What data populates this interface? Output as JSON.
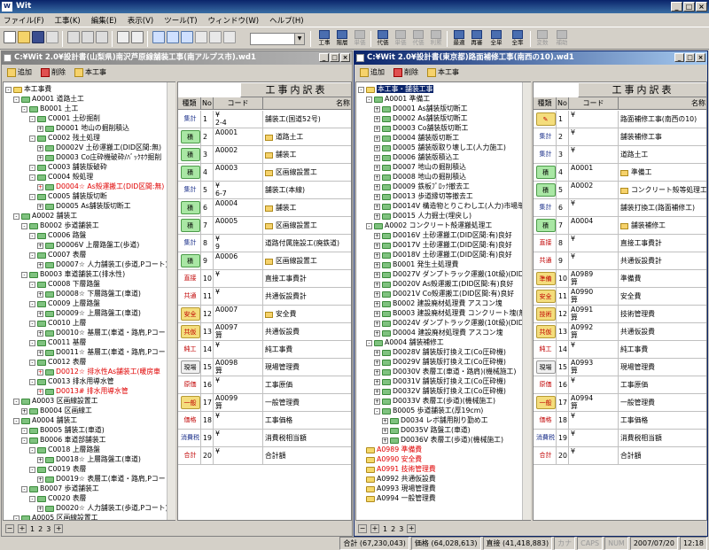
{
  "app": {
    "title": "Wit",
    "icon_label": "W"
  },
  "window_buttons": [
    "_",
    "□",
    "×"
  ],
  "menu": [
    "ファイル(F)",
    "工事(K)",
    "編集(E)",
    "表示(V)",
    "ツール(T)",
    "ウィンドウ(W)",
    "ヘルプ(H)"
  ],
  "toolbar": {
    "right_buttons": [
      {
        "label": "工事",
        "disabled": false
      },
      {
        "label": "階層",
        "disabled": false
      },
      {
        "label": "単価",
        "disabled": true
      },
      {
        "label": "代価",
        "disabled": false
      },
      {
        "label": "単価",
        "disabled": true
      },
      {
        "label": "代価",
        "disabled": true
      },
      {
        "label": "利累",
        "disabled": true
      },
      {
        "label": "最適",
        "disabled": false
      },
      {
        "label": "再審",
        "disabled": false
      },
      {
        "label": "全単",
        "disabled": false
      },
      {
        "label": "全率",
        "disabled": false
      },
      {
        "label": "変数",
        "disabled": true
      },
      {
        "label": "補助",
        "disabled": true
      }
    ]
  },
  "left_window": {
    "title": "C:¥Wit 2.0¥設計書(山梨県)南沢芦原線舗装工事(南アルプス市).wd1",
    "toolbar": {
      "add": "追加",
      "delete": "削除",
      "main": "本工事"
    },
    "grid_title": "工事内訳表",
    "columns": {
      "kind": "種類",
      "no": "No",
      "code": "コード",
      "name": "名称"
    },
    "tree": [
      {
        "level": 0,
        "text": "本工事費",
        "folder": "y",
        "pm": "-"
      },
      {
        "level": 1,
        "text": "A0001 道路土工",
        "pm": "-"
      },
      {
        "level": 2,
        "text": "B0001 土工",
        "pm": "-"
      },
      {
        "level": 3,
        "text": "C0001 土砂掘削",
        "pm": "-"
      },
      {
        "level": 4,
        "text": "D0001 地山の掘削積込",
        "pm": "+"
      },
      {
        "level": 3,
        "text": "C0002 残土処理",
        "pm": "-"
      },
      {
        "level": 4,
        "text": "D0002V 土砂運搬工(DID区間:無)",
        "pm": "+"
      },
      {
        "level": 4,
        "text": "D0003 Co庄砕機破砕/ﾊﾞｯｸﾎｳ掘削",
        "pm": "+"
      },
      {
        "level": 3,
        "text": "C0003 舗装版破砕",
        "pm": "-"
      },
      {
        "level": 3,
        "text": "C0004 殻処理",
        "pm": "-"
      },
      {
        "level": 4,
        "text": "D0004☆ As殻運搬工(DID区間:無)",
        "pm": "+",
        "red": true
      },
      {
        "level": 3,
        "text": "C0005 舗装版切断",
        "pm": "-"
      },
      {
        "level": 4,
        "text": "D0005 As舗装版切断工",
        "pm": "+"
      },
      {
        "level": 1,
        "text": "A0002 舗装工",
        "pm": "-"
      },
      {
        "level": 2,
        "text": "B0002 歩道舗装工",
        "pm": "-"
      },
      {
        "level": 3,
        "text": "C0006 路盤",
        "pm": "-"
      },
      {
        "level": 4,
        "text": "D0006V 上層路盤工(歩道)",
        "pm": "+"
      },
      {
        "level": 3,
        "text": "C0007 表層",
        "pm": "-"
      },
      {
        "level": 4,
        "text": "D0007☆ 人力舗装工(歩道,Pコート)",
        "pm": "+"
      },
      {
        "level": 2,
        "text": "B0003 車道舗装工(排水性)",
        "pm": "-"
      },
      {
        "level": 3,
        "text": "C0008 下層路盤",
        "pm": "-"
      },
      {
        "level": 4,
        "text": "D0008☆ 下層路盤工(車道)",
        "pm": "+"
      },
      {
        "level": 3,
        "text": "C0009 上層路盤",
        "pm": "-"
      },
      {
        "level": 4,
        "text": "D0009☆ 上層路盤工(車道)",
        "pm": "+"
      },
      {
        "level": 3,
        "text": "C0010 上層",
        "pm": "-"
      },
      {
        "level": 4,
        "text": "D0010☆ 基層工(車道・路肩,Pコート)",
        "pm": "+"
      },
      {
        "level": 3,
        "text": "C0011 基層",
        "pm": "-"
      },
      {
        "level": 4,
        "text": "D0011☆ 基層工(車道・路肩,Pコート)",
        "pm": "+"
      },
      {
        "level": 3,
        "text": "C0012 表層",
        "pm": "-"
      },
      {
        "level": 4,
        "text": "D0012☆ 排水性As舗装工(暖房車",
        "pm": "+",
        "red": true
      },
      {
        "level": 3,
        "text": "C0013 排水用導水管",
        "pm": "-"
      },
      {
        "level": 4,
        "text": "D0013# 排水用導水管",
        "pm": "+",
        "red": true
      },
      {
        "level": 1,
        "text": "A0003 区画線設置工",
        "pm": "-"
      },
      {
        "level": 2,
        "text": "B0004 区画線工",
        "pm": "+"
      },
      {
        "level": 1,
        "text": "A0004 舗装工",
        "pm": "-"
      },
      {
        "level": 2,
        "text": "B0005 舗装工(車道)",
        "pm": "-"
      },
      {
        "level": 2,
        "text": "B0006 車道部舗装工",
        "pm": "-"
      },
      {
        "level": 3,
        "text": "C0018 上層路盤",
        "pm": "-"
      },
      {
        "level": 4,
        "text": "D0018☆ 上層路盤工(車道)",
        "pm": "+"
      },
      {
        "level": 3,
        "text": "C0019 表層",
        "pm": "-"
      },
      {
        "level": 4,
        "text": "D0019☆ 表層工(車道・路肩,Pコート)",
        "pm": "+"
      },
      {
        "level": 2,
        "text": "B0007 歩道舗装工",
        "pm": "-"
      },
      {
        "level": 3,
        "text": "C0020 表層",
        "pm": "-"
      },
      {
        "level": 4,
        "text": "D0020☆ 人力舗装工(歩道,Pコート)",
        "pm": "+"
      },
      {
        "level": 1,
        "text": "A0005 区画線設置工",
        "pm": "-"
      },
      {
        "level": 2,
        "text": "B0008 区画線工",
        "pm": "-"
      },
      {
        "level": 3,
        "text": "C0021 溶融式区画線(停止線,横断歩",
        "pm": "+"
      },
      {
        "level": 3,
        "text": "C0022 溶融式区画線(中央,外側,車)",
        "pm": "+"
      },
      {
        "level": 3,
        "text": "C0023 溶融式区画線(自転車,横断線)",
        "pm": "+"
      }
    ],
    "rows": [
      {
        "kind": "集計",
        "style": "ts",
        "no": "1",
        "code": "¥\n2-4",
        "name": "舗装工(国道52号)"
      },
      {
        "kind": "積",
        "style": "green",
        "no": "2",
        "code": "A0001",
        "name": "道路土工",
        "folder": true
      },
      {
        "kind": "積",
        "style": "green",
        "no": "3",
        "code": "A0002",
        "name": "舗装工",
        "folder": true
      },
      {
        "kind": "積",
        "style": "green",
        "no": "4",
        "code": "A0003",
        "name": "区画線設置工",
        "folder": true
      },
      {
        "kind": "集計",
        "style": "ts",
        "no": "5",
        "code": "¥\n6-7",
        "name": "舗装工(本線)"
      },
      {
        "kind": "積",
        "style": "green",
        "no": "6",
        "code": "A0004",
        "name": "舗装工",
        "folder": true
      },
      {
        "kind": "積",
        "style": "green",
        "no": "7",
        "code": "A0005",
        "name": "区画線設置工",
        "folder": true
      },
      {
        "kind": "集計",
        "style": "ts",
        "no": "8",
        "code": "¥\n9",
        "name": "道路付属施設工(廃鉄道)"
      },
      {
        "kind": "積",
        "style": "green",
        "no": "9",
        "code": "A0006",
        "name": "区画線設置工",
        "folder": true
      },
      {
        "kind": "直接",
        "style": "red",
        "no": "10",
        "code": "¥",
        "name": "直接工事費計"
      },
      {
        "kind": "共通",
        "style": "red",
        "no": "11",
        "code": "¥",
        "name": "共通仮設費計"
      },
      {
        "kind": "安全",
        "style": "yellow",
        "no": "12",
        "code": "A0007",
        "name": "安全費",
        "folder": true
      },
      {
        "kind": "共仮",
        "style": "yellow",
        "no": "13",
        "code": "A0097\n算",
        "name": "共通仮設費"
      },
      {
        "kind": "純工",
        "style": "red",
        "no": "14",
        "code": "¥",
        "name": "純工事費"
      },
      {
        "kind": "現場",
        "style": "plain",
        "no": "15",
        "code": "A0098\n算",
        "name": "現場管理費"
      },
      {
        "kind": "原価",
        "style": "red",
        "no": "16",
        "code": "¥",
        "name": "工事原価"
      },
      {
        "kind": "一般",
        "style": "yellow",
        "no": "17",
        "code": "A0099\n算",
        "name": "一般管理費"
      },
      {
        "kind": "価格",
        "style": "red",
        "no": "18",
        "code": "¥",
        "name": "工事価格"
      },
      {
        "kind": "消費税",
        "style": "ts",
        "no": "19",
        "code": "¥",
        "name": "消費税相当額"
      },
      {
        "kind": "合計",
        "style": "red",
        "no": "20",
        "code": "¥",
        "name": "合計額"
      }
    ],
    "pages": [
      "1",
      "2",
      "3"
    ]
  },
  "right_window": {
    "title": "C:¥Wit 2.0¥設計書(東京都)路面補修工事(南西の10).wd1",
    "toolbar": {
      "add": "追加",
      "delete": "削除",
      "main": "本工事"
    },
    "grid_title": "工事内訳表",
    "columns": {
      "kind": "種類",
      "no": "No",
      "code": "コード",
      "name": "名称"
    },
    "tree": [
      {
        "level": 0,
        "text": "本工事・舗装工事",
        "folder": "y",
        "pm": "-",
        "sel": true
      },
      {
        "level": 1,
        "text": "A0001 準備工",
        "pm": "-"
      },
      {
        "level": 2,
        "text": "D0001 As舗装版切断工",
        "pm": "+"
      },
      {
        "level": 2,
        "text": "D0002 As舗装版切断工",
        "pm": "+"
      },
      {
        "level": 2,
        "text": "D0003 Co舗装版切断工",
        "pm": "+"
      },
      {
        "level": 2,
        "text": "D0004 舗装版切断工",
        "pm": "+"
      },
      {
        "level": 2,
        "text": "D0005 舗装版取り壊し工(人力施工)",
        "pm": "+"
      },
      {
        "level": 2,
        "text": "D0006 舗装版積込工",
        "pm": "+"
      },
      {
        "level": 2,
        "text": "D0007 地山の掘削積込",
        "pm": "+"
      },
      {
        "level": 2,
        "text": "D0008 地山の掘削積込",
        "pm": "+"
      },
      {
        "level": 2,
        "text": "D0009 鉄板ﾌﾟﾛｯｸ撤去工",
        "pm": "+"
      },
      {
        "level": 2,
        "text": "D0013 歩道縁切等撤去工",
        "pm": "+"
      },
      {
        "level": 2,
        "text": "D0014V 構造物とりこわし工(人力)市場単価",
        "pm": "+"
      },
      {
        "level": 2,
        "text": "D0015 人力掘士(埋戻し)",
        "pm": "+"
      },
      {
        "level": 1,
        "text": "A0002 コンクリート殻運搬処理工",
        "pm": "-"
      },
      {
        "level": 2,
        "text": "D0016V 土砂運搬工(DID区間:有)良好",
        "pm": "+"
      },
      {
        "level": 2,
        "text": "D0017V 土砂運搬工(DID区間:有)良好",
        "pm": "+"
      },
      {
        "level": 2,
        "text": "D0018V 土砂運搬工(DID区間:有)良好",
        "pm": "+"
      },
      {
        "level": 2,
        "text": "B0001 発生土処理費",
        "pm": "+"
      },
      {
        "level": 2,
        "text": "D0027V ダンプトラック運搬(10t級)(DID区間:有)",
        "pm": "+"
      },
      {
        "level": 2,
        "text": "D0020V As殻運搬工(DID区間:有)良好",
        "pm": "+"
      },
      {
        "level": 2,
        "text": "D0021V Co殻運搬工(DID区間:有)良好",
        "pm": "+"
      },
      {
        "level": 2,
        "text": "B0002 建設廃材処理費 アスコン塊",
        "pm": "+"
      },
      {
        "level": 2,
        "text": "B0003 建設廃材処理費 コンクリート塊(無筋)",
        "pm": "+"
      },
      {
        "level": 2,
        "text": "D0024V ダンプトラック運搬(10t級)(DID区間:有)",
        "pm": "+"
      },
      {
        "level": 2,
        "text": "D0004 建設廃材処理費 アスコン塊",
        "pm": "+"
      },
      {
        "level": 1,
        "text": "A0004 舗装補修工",
        "pm": "-"
      },
      {
        "level": 2,
        "text": "D0028V 舗装版打換え工(Co圧砕機)",
        "pm": "+"
      },
      {
        "level": 2,
        "text": "D0029V 舗装版打換え工(Co圧砕機)",
        "pm": "+"
      },
      {
        "level": 2,
        "text": "D0030V 表層工(車道・路肩)(機械施工)",
        "pm": "+"
      },
      {
        "level": 2,
        "text": "D0031V 舗装版打換え工(Co圧砕機)",
        "pm": "+"
      },
      {
        "level": 2,
        "text": "D0032V 舗装版打換え工(Co圧砕機)",
        "pm": "+"
      },
      {
        "level": 2,
        "text": "D0033V 表層工(歩道)(機械施工)",
        "pm": "+"
      },
      {
        "level": 2,
        "text": "B0005 歩道舗装工(厚19cm)",
        "pm": "-"
      },
      {
        "level": 3,
        "text": "D0034 レボ舗用削り勤め工",
        "pm": "+"
      },
      {
        "level": 3,
        "text": "D0035V 路盤工(車道)",
        "pm": "+"
      },
      {
        "level": 3,
        "text": "D0036V 表層工(歩道)(機械施工)",
        "pm": "+"
      },
      {
        "level": 1,
        "text": "A0989 準備費",
        "folder": "y",
        "red": true
      },
      {
        "level": 1,
        "text": "A0990 安全費",
        "folder": "y",
        "red": true
      },
      {
        "level": 1,
        "text": "A0991 技術管理費",
        "folder": "y",
        "red": true
      },
      {
        "level": 1,
        "text": "A0992 共通仮設費",
        "folder": "y"
      },
      {
        "level": 1,
        "text": "A0993 現場管理費",
        "folder": "y"
      },
      {
        "level": 1,
        "text": "A0994 一般管理費",
        "folder": "y"
      }
    ],
    "rows": [
      {
        "kind": "✎",
        "style": "yellow",
        "no": "1",
        "code": "¥",
        "name": "路面補修工事(南西の10)"
      },
      {
        "kind": "集計",
        "style": "ts",
        "no": "2",
        "code": "¥",
        "name": "舗装補修工事"
      },
      {
        "kind": "集計",
        "style": "ts",
        "no": "3",
        "code": "¥",
        "name": "道路土工"
      },
      {
        "kind": "積",
        "style": "green",
        "no": "4",
        "code": "A0001",
        "name": "準備工",
        "folder": true
      },
      {
        "kind": "積",
        "style": "green",
        "no": "5",
        "code": "A0002",
        "name": "コンクリート殻等処理工",
        "folder": true
      },
      {
        "kind": "集計",
        "style": "ts",
        "no": "6",
        "code": "¥",
        "name": "舗装打換工(路面補修工)"
      },
      {
        "kind": "積",
        "style": "green",
        "no": "7",
        "code": "A0004",
        "name": "舗装補修工",
        "folder": true
      },
      {
        "kind": "直接",
        "style": "red",
        "no": "8",
        "code": "¥",
        "name": "直接工事費計"
      },
      {
        "kind": "共通",
        "style": "red",
        "no": "9",
        "code": "¥",
        "name": "共通仮設費計"
      },
      {
        "kind": "準備",
        "style": "yellow",
        "no": "10",
        "code": "A0989\n算",
        "name": "準備費"
      },
      {
        "kind": "安全",
        "style": "yellow",
        "no": "11",
        "code": "A0990\n算",
        "name": "安全費"
      },
      {
        "kind": "技術",
        "style": "yellow",
        "no": "12",
        "code": "A0991\n算",
        "name": "技術管理費"
      },
      {
        "kind": "共仮",
        "style": "yellow",
        "no": "13",
        "code": "A0992\n算",
        "name": "共通仮設費"
      },
      {
        "kind": "純工",
        "style": "red",
        "no": "14",
        "code": "¥",
        "name": "純工事費"
      },
      {
        "kind": "現場",
        "style": "plain",
        "no": "15",
        "code": "A0993\n算",
        "name": "現場管理費"
      },
      {
        "kind": "原価",
        "style": "red",
        "no": "16",
        "code": "¥",
        "name": "工事原価"
      },
      {
        "kind": "一般",
        "style": "yellow",
        "no": "17",
        "code": "A0994\n算",
        "name": "一般管理費"
      },
      {
        "kind": "価格",
        "style": "red",
        "no": "18",
        "code": "¥",
        "name": "工事価格"
      },
      {
        "kind": "消費税",
        "style": "ts",
        "no": "19",
        "code": "¥",
        "name": "消費税相当額"
      },
      {
        "kind": "合計",
        "style": "red",
        "no": "20",
        "code": "¥",
        "name": "合計額"
      }
    ],
    "pages": [
      "1",
      "2",
      "3"
    ]
  },
  "status": {
    "total": "合計 (67,230,043)",
    "price": "価格 (64,028,613)",
    "direct": "直接 (41,418,883)",
    "kana": "カナ",
    "caps": "CAPS",
    "num": "NUM",
    "date": "2007/07/20",
    "time": "12:18"
  }
}
